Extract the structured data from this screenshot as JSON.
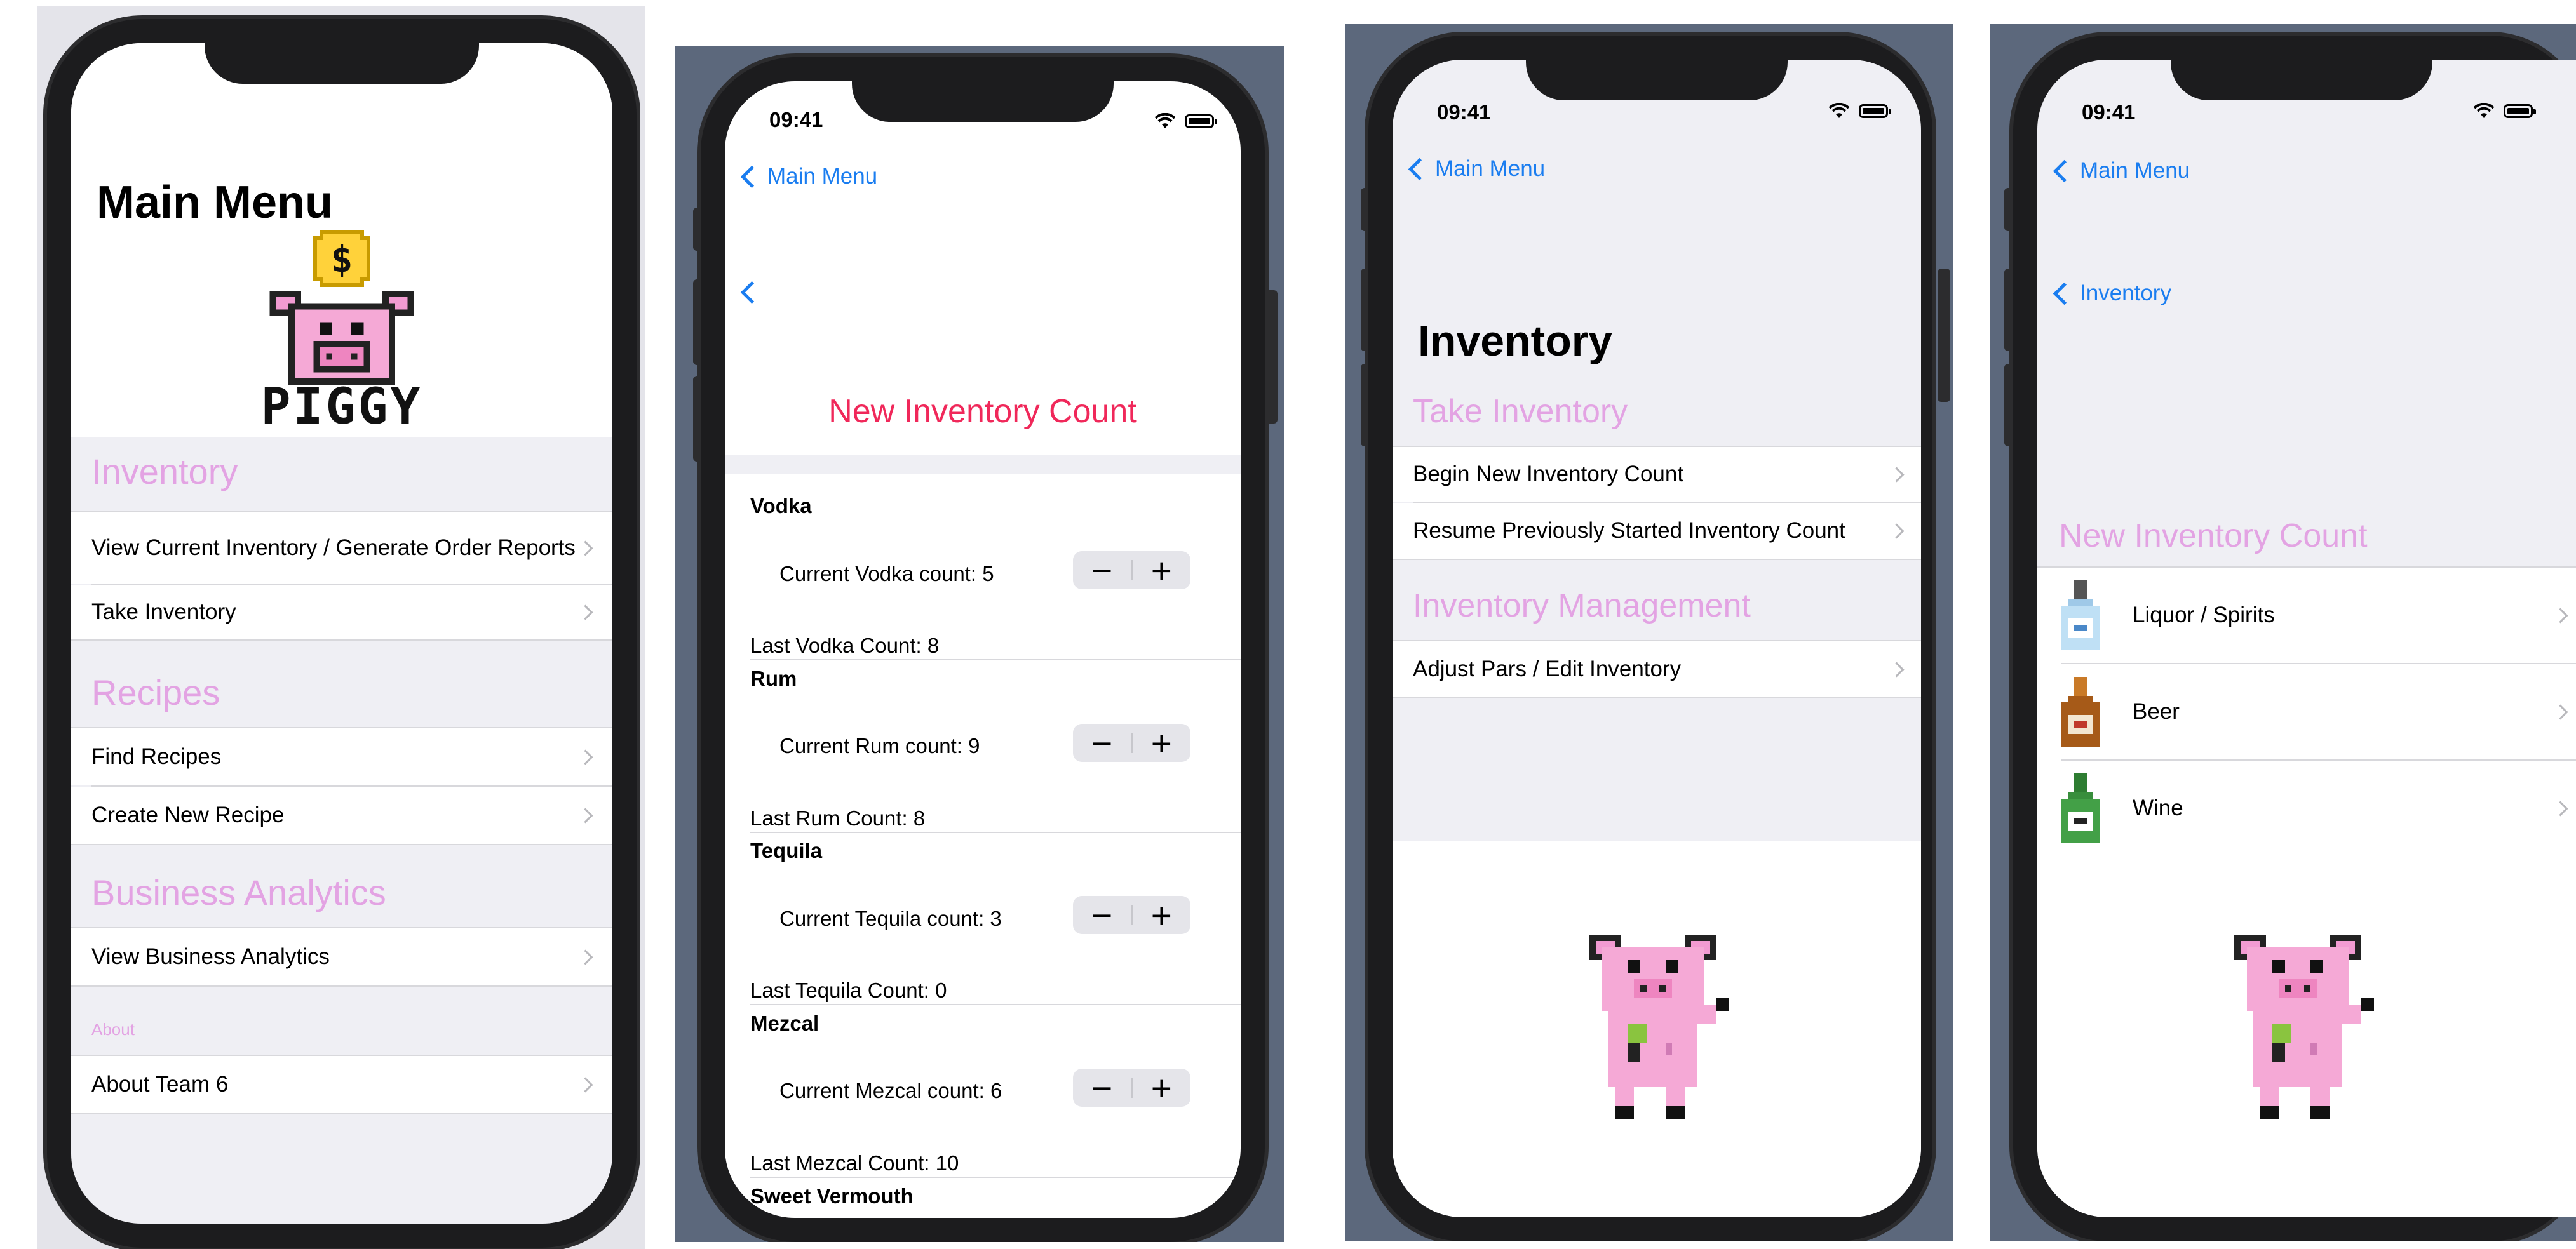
{
  "status_time": "09:41",
  "screen1": {
    "title": "Main Menu",
    "logo_text": "PIGGY",
    "logo_coin_symbol": "$",
    "sections": [
      {
        "header": "Inventory",
        "items": [
          "View Current Inventory / Generate Order Reports",
          "Take Inventory"
        ]
      },
      {
        "header": "Recipes",
        "items": [
          "Find Recipes",
          "Create New Recipe"
        ]
      },
      {
        "header": "Business Analytics",
        "items": [
          "View Business Analytics"
        ]
      },
      {
        "header": "About",
        "items": [
          "About Team 6"
        ]
      }
    ]
  },
  "screen2": {
    "back_label": "Main Menu",
    "title": "New Inventory Count",
    "items": [
      {
        "name": "Vodka",
        "current": "Current Vodka count: 5",
        "last": "Last Vodka Count: 8"
      },
      {
        "name": "Rum",
        "current": "Current Rum count: 9",
        "last": "Last Rum Count: 8"
      },
      {
        "name": "Tequila",
        "current": "Current Tequila count: 3",
        "last": "Last Tequila Count: 0"
      },
      {
        "name": "Mezcal",
        "current": "Current Mezcal count: 6",
        "last": "Last Mezcal Count: 10"
      },
      {
        "name": "Sweet Vermouth"
      }
    ],
    "stepper_minus": "−",
    "stepper_plus": "+"
  },
  "screen3": {
    "back_label": "Main Menu",
    "title": "Inventory",
    "sections": [
      {
        "header": "Take Inventory",
        "items": [
          "Begin New Inventory Count",
          "Resume Previously Started Inventory Count"
        ]
      },
      {
        "header": "Inventory Management",
        "items": [
          "Adjust Pars / Edit Inventory"
        ]
      }
    ]
  },
  "screen4": {
    "back_label": "Main Menu",
    "sub_back_label": "Inventory",
    "section_header": "New Inventory Count",
    "items": [
      {
        "label": "Liquor / Spirits",
        "icon": "liquor-bottle-icon"
      },
      {
        "label": "Beer",
        "icon": "beer-bottle-icon"
      },
      {
        "label": "Wine",
        "icon": "wine-bottle-icon"
      }
    ]
  },
  "colors": {
    "accent_blue": "#1a7df0",
    "section_pink": "#e3a3e3",
    "title_red": "#f0285a",
    "grouped_bg": "#efeff4",
    "pig_pink": "#f29bd2"
  }
}
